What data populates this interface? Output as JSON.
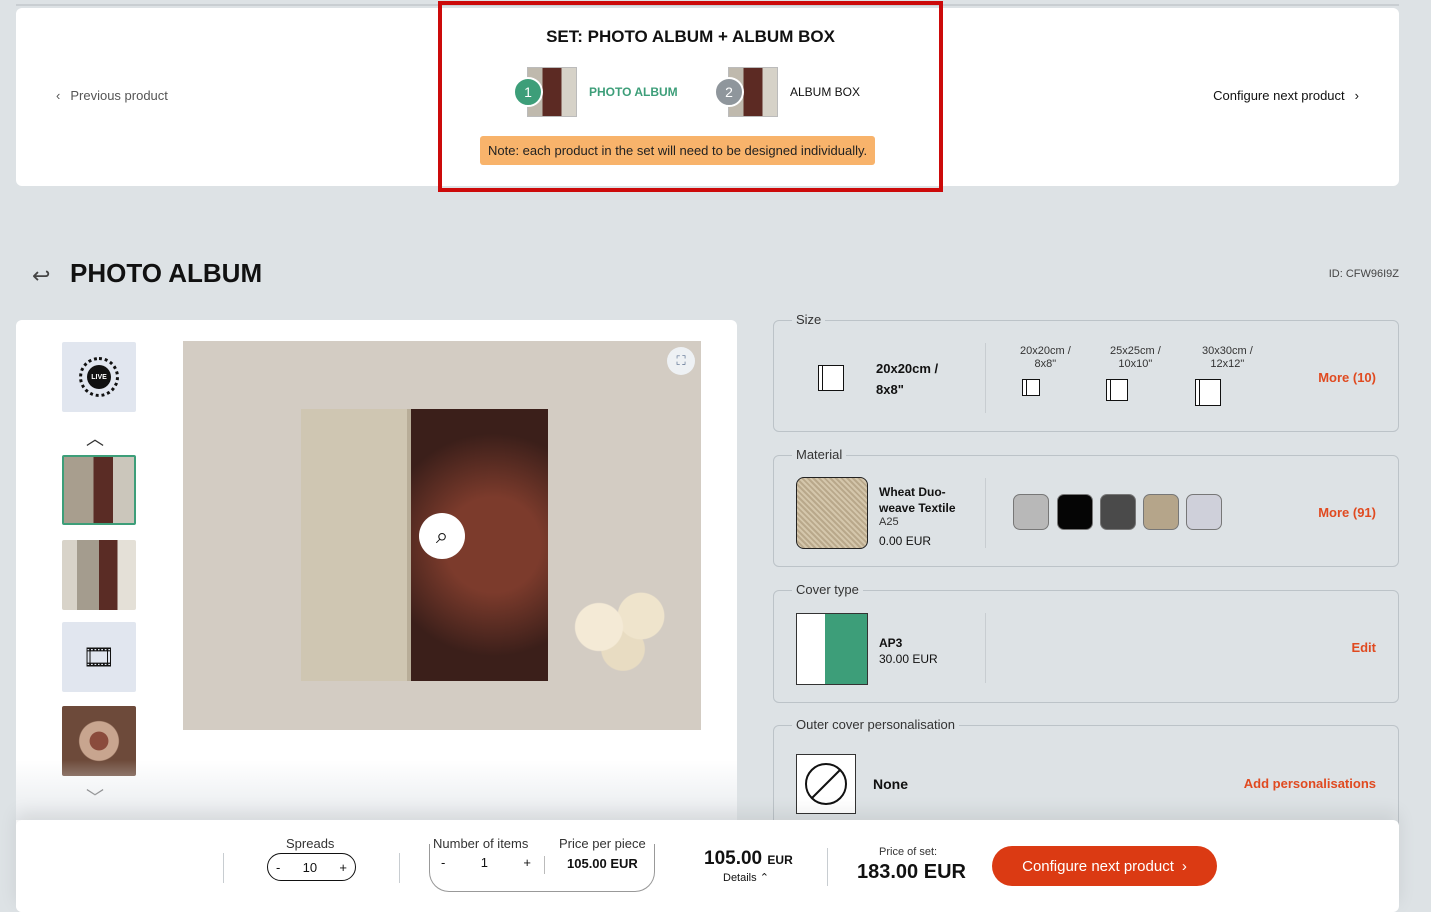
{
  "set": {
    "title": "SET: PHOTO ALBUM + ALBUM BOX",
    "steps": [
      {
        "number": "1",
        "label": "PHOTO ALBUM"
      },
      {
        "number": "2",
        "label": "ALBUM BOX"
      }
    ],
    "note": "Note: each product in the set will need to be designed individually.",
    "prev_label": "Previous product",
    "next_label": "Configure next product"
  },
  "product": {
    "title": "PHOTO ALBUM",
    "id": "ID: CFW96I9Z",
    "live_label": "LIVE"
  },
  "options": {
    "size": {
      "legend": "Size",
      "selected_line1": "20x20cm /",
      "selected_line2": "8x8\"",
      "choices": [
        {
          "line1": "20x20cm /",
          "line2": "8x8\""
        },
        {
          "line1": "25x25cm /",
          "line2": "10x10\""
        },
        {
          "line1": "30x30cm /",
          "line2": "12x12\""
        }
      ],
      "more": "More (10)"
    },
    "material": {
      "legend": "Material",
      "name": "Wheat Duo-weave Textile",
      "code": "A25",
      "price": "0.00 EUR",
      "swatch_colors": [
        "#b8b8b8",
        "#050505",
        "#4a4a4a",
        "#b5a58a",
        "#cfd0da"
      ],
      "more": "More (91)"
    },
    "cover": {
      "legend": "Cover type",
      "name": "AP3",
      "price": "30.00 EUR",
      "edit": "Edit"
    },
    "outer": {
      "legend": "Outer cover personalisation",
      "name": "None",
      "action": "Add personalisations"
    }
  },
  "bottom": {
    "spreads_label": "Spreads",
    "spreads_value": "10",
    "items_label": "Number of items",
    "items_value": "1",
    "price_piece_label": "Price per piece",
    "price_piece": "105.00 EUR",
    "total_value": "105.00",
    "total_currency": "EUR",
    "details": "Details",
    "set_price_label": "Price of set:",
    "set_price": "183.00 EUR",
    "cta": "Configure next product"
  }
}
